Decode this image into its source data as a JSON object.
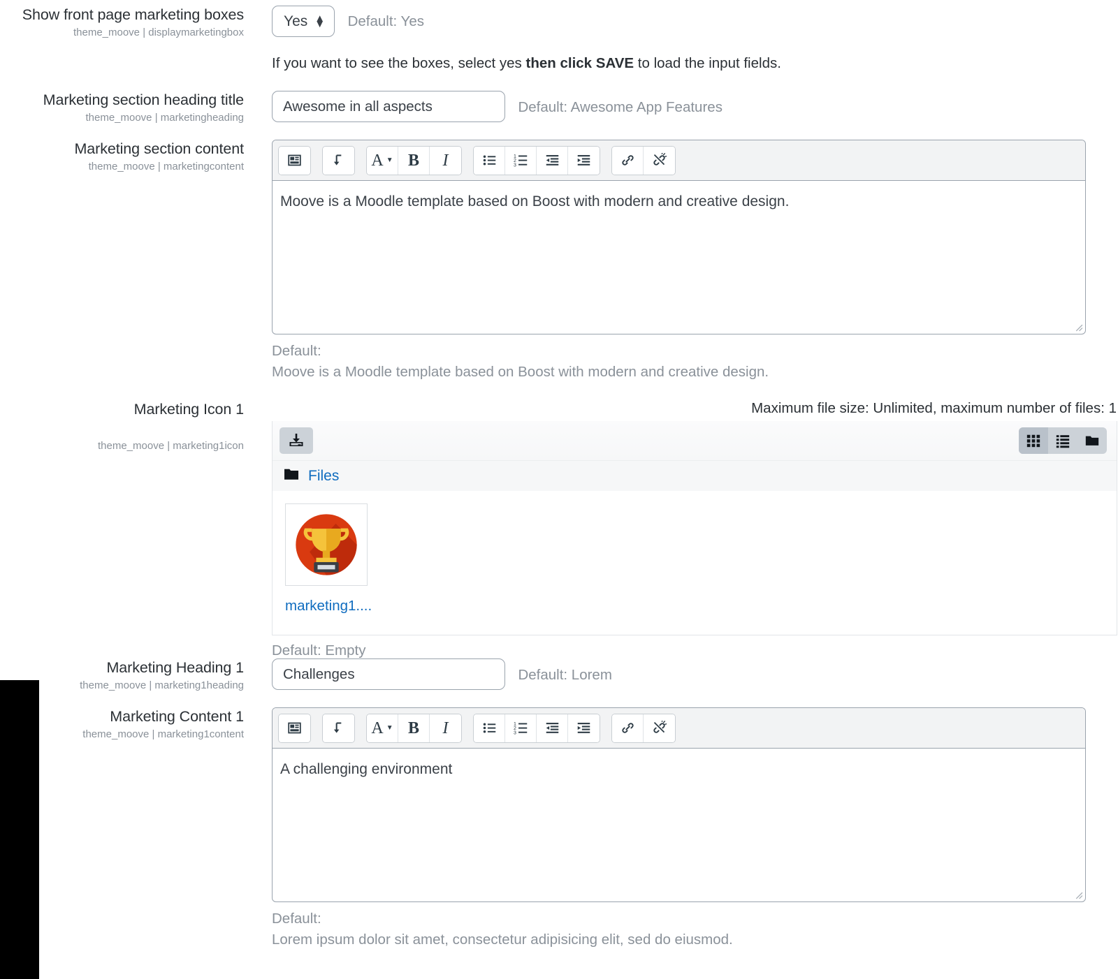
{
  "settings": [
    {
      "label": "Show front page marketing boxes",
      "sublabel": "theme_moove | displaymarketingbox",
      "select_value": "Yes",
      "default_note": "Default: Yes",
      "help_prefix": "If you want to see the boxes, select yes ",
      "help_bold": "then click SAVE",
      "help_suffix": " to load the input fields."
    },
    {
      "label": "Marketing section heading title",
      "sublabel": "theme_moove | marketingheading",
      "input_value": "Awesome in all aspects",
      "input_placeholder": "",
      "default_note": "Default: Awesome App Features"
    },
    {
      "label": "Marketing section content",
      "sublabel": "theme_moove | marketingcontent",
      "editor_text": "Moove is a Moodle template based on Boost with modern and creative design.",
      "default_label": "Default:",
      "default_value": "Moove is a Moodle template based on Boost with modern and creative design."
    },
    {
      "label": "Marketing Icon 1",
      "sublabel": "theme_moove | marketing1icon",
      "maxsize_note": "Maximum file size: Unlimited, maximum number of files: 1",
      "path_label": "Files",
      "file_name": "marketing1....",
      "default_note": "Default: Empty"
    },
    {
      "label": "Marketing Heading 1",
      "sublabel": "theme_moove | marketing1heading",
      "input_value": "Challenges",
      "input_placeholder": "",
      "default_note": "Default: Lorem"
    },
    {
      "label": "Marketing Content 1",
      "sublabel": "theme_moove | marketing1content",
      "editor_text": "A challenging environment",
      "default_label": "Default:",
      "default_value": "Lorem ipsum dolor sit amet, consectetur adipisicing elit, sed do eiusmod."
    }
  ],
  "editor_toolbar": {
    "groups": [
      {
        "buttons": [
          {
            "icon": "image-icon",
            "title": "Image"
          }
        ]
      },
      {
        "buttons": [
          {
            "icon": "line-break-icon",
            "title": "Line break"
          }
        ]
      },
      {
        "buttons": [
          {
            "icon": "font-style-icon",
            "title": "Paragraph styles"
          },
          {
            "icon": "bold-icon",
            "title": "Bold"
          },
          {
            "icon": "italic-icon",
            "title": "Italic"
          }
        ]
      },
      {
        "buttons": [
          {
            "icon": "bulleted-list-icon",
            "title": "Bulleted list"
          },
          {
            "icon": "numbered-list-icon",
            "title": "Numbered list"
          },
          {
            "icon": "outdent-icon",
            "title": "Decrease indent"
          },
          {
            "icon": "indent-icon",
            "title": "Increase indent"
          }
        ]
      },
      {
        "buttons": [
          {
            "icon": "link-icon",
            "title": "Link"
          },
          {
            "icon": "unlink-icon",
            "title": "Unlink"
          }
        ]
      }
    ]
  },
  "filemanager": {
    "add_file_icon": "add-file-icon",
    "views": [
      {
        "icon": "grid-view-icon",
        "active": true
      },
      {
        "icon": "list-view-icon",
        "active": false
      },
      {
        "icon": "tree-view-icon",
        "active": false
      }
    ],
    "folder_icon": "folder-icon",
    "thumbnail_icon": "trophy-icon"
  },
  "colors": {
    "link": "#0f6cbf",
    "muted": "#8a9199",
    "text": "#2b3035",
    "border": "#9aa3ad",
    "toolbar_bg": "#f2f3f4",
    "trophy_bg": "#d93a10",
    "trophy_shadow": "#a81f08",
    "trophy_gold": "#f2b632"
  }
}
